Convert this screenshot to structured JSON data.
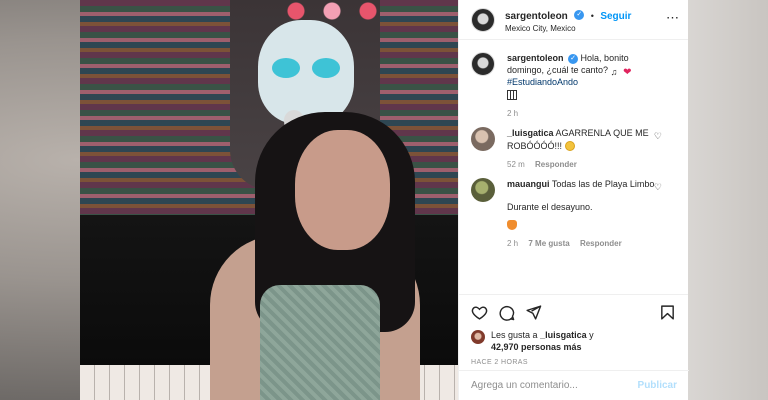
{
  "post": {
    "username": "sargentoleon",
    "follow_label": "Seguir",
    "dot": "•",
    "location": "Mexico City, Mexico",
    "more_label": "•••"
  },
  "caption": {
    "username": "sargentoleon",
    "text": "Hola, bonito domingo, ¿cuál te canto?",
    "hashtag": "#EstudiandoAndo",
    "time": "2 h"
  },
  "comments": [
    {
      "username": "_luisgatica",
      "text": "AGARRENLA QUE ME ROBÓÓÓÓ!!!",
      "time": "52 m",
      "likes": "",
      "reply_label": "Responder"
    },
    {
      "username": "mauangui",
      "text": "Todas las de Playa Limbo",
      "text2": "Durante el desayuno.",
      "time": "2 h",
      "likes": "7 Me gusta",
      "reply_label": "Responder"
    }
  ],
  "likes": {
    "prefix": "Les gusta a",
    "user": "_luisgatica",
    "join": "y",
    "count": "42,970 personas más"
  },
  "timestamp": "HACE 2 HORAS",
  "add_comment": {
    "placeholder": "Agrega un comentario...",
    "publish_label": "Publicar"
  },
  "icons": {
    "verified": "verified-badge-icon",
    "like": "heart-icon",
    "comment": "comment-icon",
    "share": "share-icon",
    "save": "bookmark-icon"
  },
  "colors": {
    "link": "#0095f6",
    "verified": "#3897f0",
    "publish_disabled": "#b2dffc",
    "hashtag": "#00376b"
  }
}
